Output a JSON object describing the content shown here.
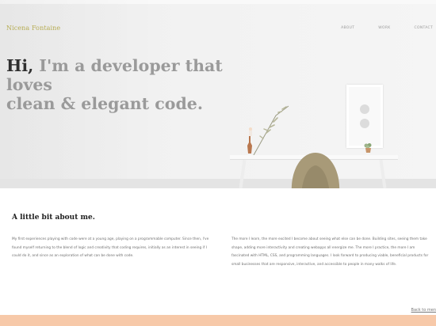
{
  "site": {
    "brand": "Nicena Fontaine",
    "nav": [
      "ABOUT",
      "WORK",
      "CONTACT"
    ],
    "headline": {
      "greeting": "Hi,",
      "rest_line1": " I'm a developer that loves",
      "line2": "clean & elegant code."
    }
  },
  "about": {
    "title": "A little bit about me.",
    "paragraph_left": "My first experiences playing with code were at a young age, playing on a programmable computer. Since then, I've found myself returning to the blend of logic and creativity that coding requires, initially as an interest in seeing if I could do it, and since as an exploration of what can be done with code.",
    "paragraph_right": "The more I learn, the more excited I become about seeing what else can be done. Building sites, seeing them take shape, adding more interactivity and creating webapps all energize me. The more I practice, the more I am fascinated with HTML, CSS, and programming languages. I look forward to producing viable, beneficial products for small businesses that are responsive, interactive, and accessible to people in many walks of life."
  },
  "footer": {
    "back_link": "Back to men"
  },
  "colors": {
    "brand": "#b7ad55",
    "footer_bar": "#f7c9a9",
    "chair": "#a89a78"
  }
}
